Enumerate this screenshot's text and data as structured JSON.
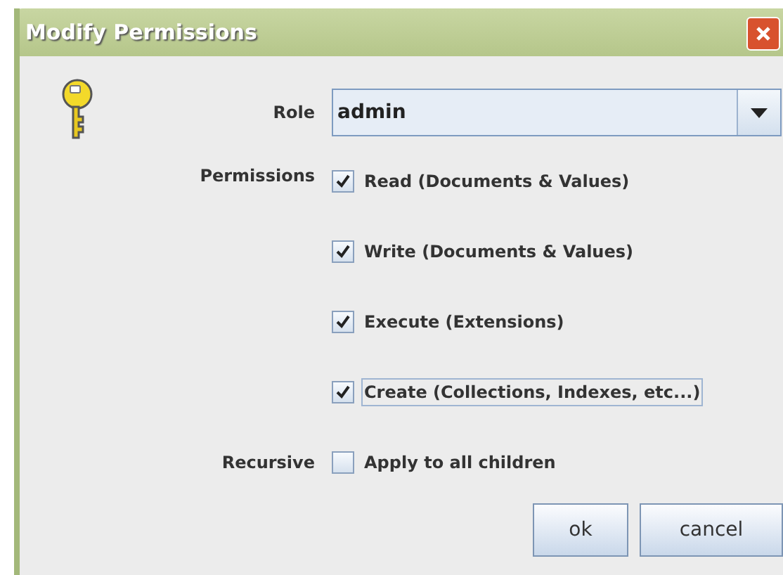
{
  "window": {
    "title": "Modify Permissions"
  },
  "role": {
    "label": "Role",
    "value": "admin"
  },
  "permissions": {
    "label": "Permissions",
    "items": [
      {
        "label": "Read (Documents & Values)",
        "checked": true,
        "focused": false
      },
      {
        "label": "Write (Documents & Values)",
        "checked": true,
        "focused": false
      },
      {
        "label": "Execute (Extensions)",
        "checked": true,
        "focused": false
      },
      {
        "label": "Create (Collections, Indexes, etc...)",
        "checked": true,
        "focused": true
      }
    ]
  },
  "recursive": {
    "label": "Recursive",
    "option": {
      "label": "Apply to all children",
      "checked": false
    }
  },
  "buttons": [
    "ok",
    "cancel"
  ]
}
